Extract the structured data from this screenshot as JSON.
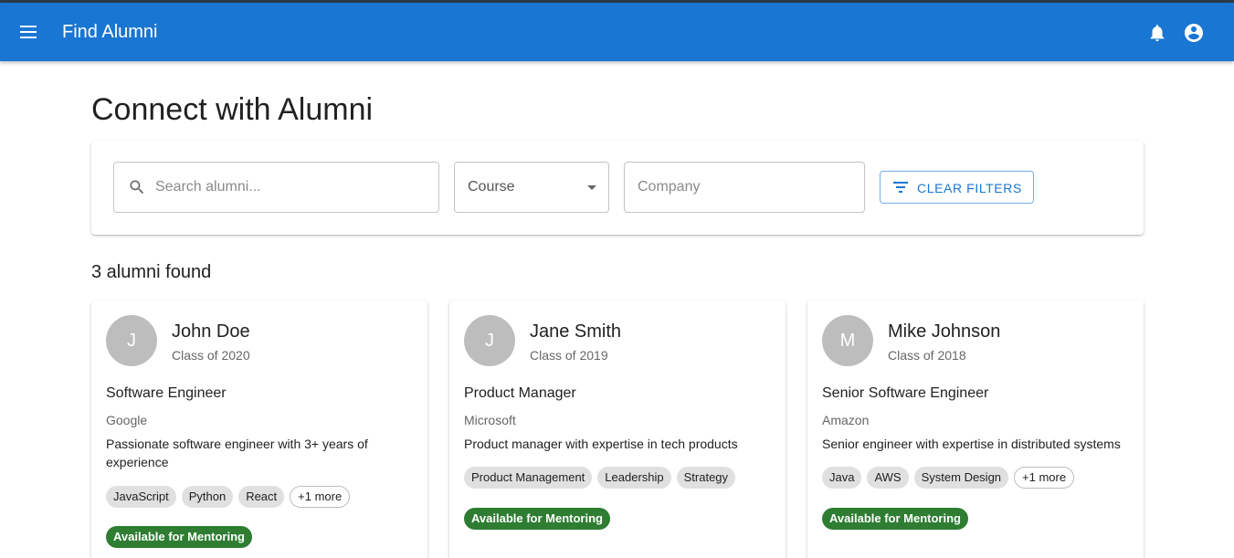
{
  "appbar": {
    "title": "Find Alumni"
  },
  "page": {
    "title": "Connect with Alumni"
  },
  "filters": {
    "search_placeholder": "Search alumni...",
    "course_label": "Course",
    "company_placeholder": "Company",
    "clear_label": "CLEAR FILTERS"
  },
  "results": {
    "count_text": "3 alumni found"
  },
  "alumni": [
    {
      "initial": "J",
      "name": "John Doe",
      "class_year": "Class of 2020",
      "role": "Software Engineer",
      "company": "Google",
      "bio": "Passionate software engineer with 3+ years of experience",
      "skills": [
        "JavaScript",
        "Python",
        "React"
      ],
      "more": "+1 more",
      "badge": "Available for Mentoring"
    },
    {
      "initial": "J",
      "name": "Jane Smith",
      "class_year": "Class of 2019",
      "role": "Product Manager",
      "company": "Microsoft",
      "bio": "Product manager with expertise in tech products",
      "skills": [
        "Product Management",
        "Leadership",
        "Strategy"
      ],
      "badge": "Available for Mentoring"
    },
    {
      "initial": "M",
      "name": "Mike Johnson",
      "class_year": "Class of 2018",
      "role": "Senior Software Engineer",
      "company": "Amazon",
      "bio": "Senior engineer with expertise in distributed systems",
      "skills": [
        "Java",
        "AWS",
        "System Design"
      ],
      "more": "+1 more",
      "badge": "Available for Mentoring"
    }
  ],
  "colors": {
    "primary": "#1976d2",
    "mentor_badge": "#2e7d32",
    "avatar": "#bdbdbd"
  },
  "icons": [
    "menu-icon",
    "bell-icon",
    "account-circle-icon",
    "search-icon",
    "dropdown-icon",
    "filter-icon"
  ]
}
